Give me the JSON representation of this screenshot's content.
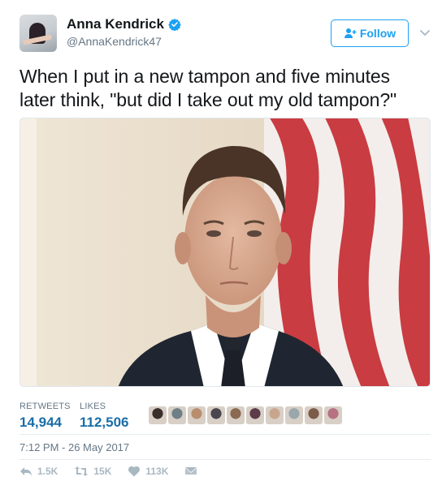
{
  "user": {
    "display_name": "Anna Kendrick",
    "handle": "@AnnaKendrick47",
    "verified": true
  },
  "header": {
    "follow_label": "Follow",
    "icons": [
      "follow-icon",
      "chevron-down-icon",
      "verified-badge-icon"
    ]
  },
  "tweet": {
    "text": "When I put in a new tampon and five minutes later think, \"but did I take out my old tampon?\""
  },
  "stats": {
    "retweets_label": "RETWEETS",
    "retweets_value": "14,944",
    "likes_label": "LIKES",
    "likes_value": "112,506"
  },
  "liker_faces": [
    {
      "color": "#3a2f2c"
    },
    {
      "color": "#6f7f88"
    },
    {
      "color": "#b98e6e"
    },
    {
      "color": "#4a4650"
    },
    {
      "color": "#8a6a52"
    },
    {
      "color": "#5d3b49"
    },
    {
      "color": "#c8a68e"
    },
    {
      "color": "#9aa7ad"
    },
    {
      "color": "#7c5b48"
    },
    {
      "color": "#b77182"
    }
  ],
  "timestamp": "7:12 PM - 26 May 2017",
  "actions": {
    "reply_count": "1.5K",
    "retweet_count": "15K",
    "like_count": "113K",
    "icons": [
      "reply-icon",
      "retweet-icon",
      "like-icon",
      "message-icon"
    ]
  },
  "colors": {
    "accent": "#1da1f2",
    "stat_value": "#1b6ea8",
    "muted": "#657786",
    "action_icon": "#aab8c2"
  }
}
